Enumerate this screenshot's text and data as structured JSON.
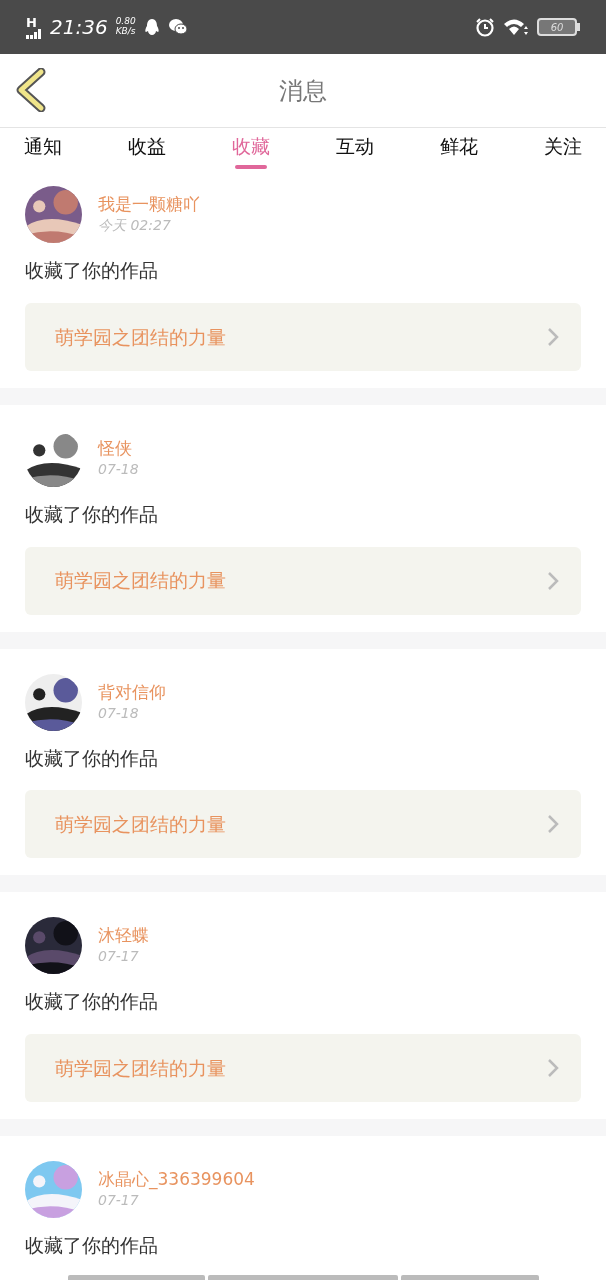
{
  "status_bar": {
    "network": "H",
    "time": "21:36",
    "speed": "0.80",
    "speed_unit": "KB/s",
    "battery": "60"
  },
  "header": {
    "title": "消息"
  },
  "tabs": [
    {
      "label": "通知",
      "selected": false
    },
    {
      "label": "收益",
      "selected": false
    },
    {
      "label": "收藏",
      "selected": true
    },
    {
      "label": "互动",
      "selected": false
    },
    {
      "label": "鲜花",
      "selected": false
    },
    {
      "label": "关注",
      "selected": false
    }
  ],
  "messages": [
    {
      "user": "我是一颗糖吖",
      "time": "今天  02:27",
      "text": "收藏了你的作品",
      "work": "萌学园之团结的力量"
    },
    {
      "user": "怪侠",
      "time": "07-18",
      "text": "收藏了你的作品",
      "work": "萌学园之团结的力量"
    },
    {
      "user": "背对信仰",
      "time": "07-18",
      "text": "收藏了你的作品",
      "work": "萌学园之团结的力量"
    },
    {
      "user": "沐轻蝶",
      "time": "07-17",
      "text": "收藏了你的作品",
      "work": "萌学园之团结的力量"
    },
    {
      "user": "冰晶心_336399604",
      "time": "07-17",
      "text": "收藏了你的作品"
    }
  ]
}
